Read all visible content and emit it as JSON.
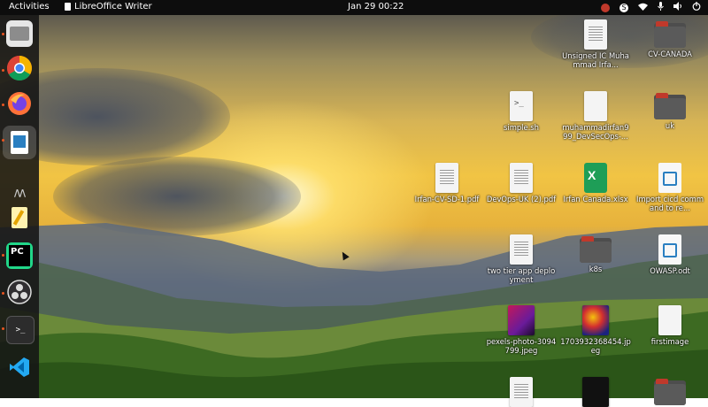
{
  "topbar": {
    "activities": "Activities",
    "app_name": "LibreOffice Writer",
    "clock": "Jan 29  00:22"
  },
  "dock": {
    "items": [
      {
        "name": "files",
        "running": true
      },
      {
        "name": "google-chrome",
        "running": true
      },
      {
        "name": "firefox",
        "running": true
      },
      {
        "name": "libreoffice-writer",
        "running": true,
        "active": true
      },
      {
        "name": "terminal-app",
        "running": false
      },
      {
        "name": "text-editor",
        "running": false
      },
      {
        "name": "pycharm",
        "running": true
      },
      {
        "name": "obs-studio",
        "running": true
      },
      {
        "name": "terminal",
        "running": true
      },
      {
        "name": "vscode",
        "running": false
      }
    ]
  },
  "desktop": {
    "icons": [
      {
        "label": "Unsigned IC Muhammad Irfa...",
        "type": "document"
      },
      {
        "label": "CV-CANADA",
        "type": "folder"
      },
      {
        "label": "simple.sh",
        "type": "script"
      },
      {
        "label": "muhammadirfan999_DevSecOps-...",
        "type": "document"
      },
      {
        "label": "uk",
        "type": "folder"
      },
      {
        "label": "Irfan-CV-SD-1.pdf",
        "type": "pdf"
      },
      {
        "label": "DevOps-UK (2).pdf",
        "type": "pdf"
      },
      {
        "label": "Irfan Canada.xlsx",
        "type": "spreadsheet"
      },
      {
        "label": "Import cicd command to re...",
        "type": "odt"
      },
      {
        "label": "two tier app deployment",
        "type": "text"
      },
      {
        "label": "k8s",
        "type": "folder"
      },
      {
        "label": "OWASP.odt",
        "type": "odt"
      },
      {
        "label": "pexels-photo-3094799.jpeg",
        "type": "image"
      },
      {
        "label": "1703932368454.jpeg",
        "type": "image"
      },
      {
        "label": "firstimage",
        "type": "text"
      }
    ]
  }
}
